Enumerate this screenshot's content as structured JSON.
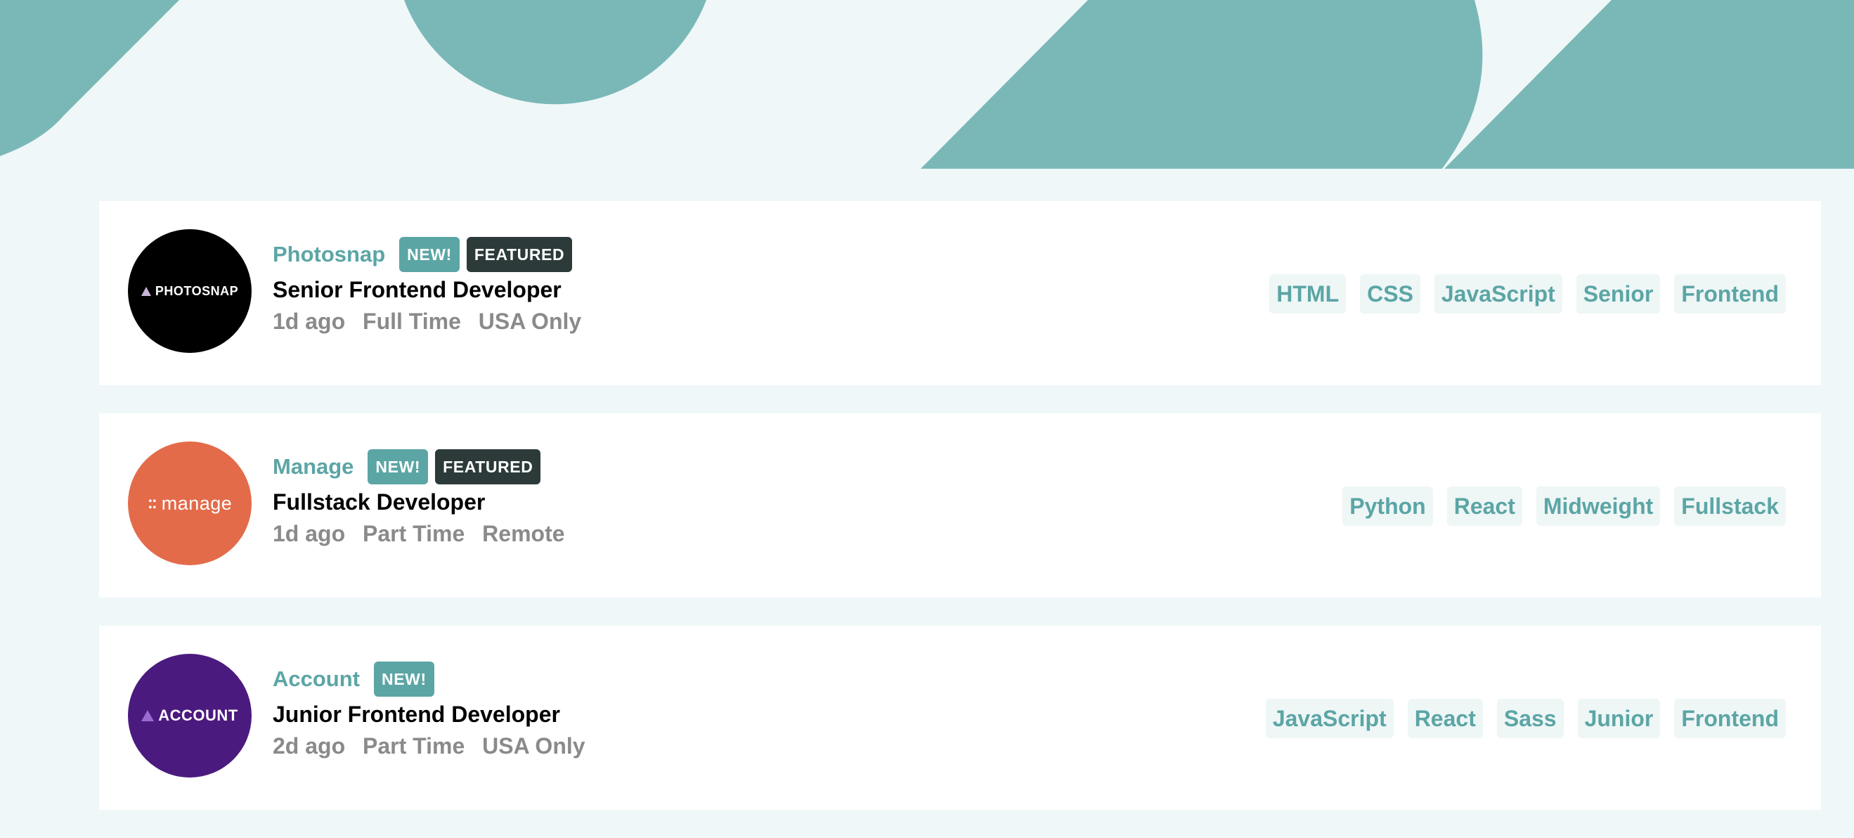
{
  "theme": {
    "primary": "#5ca5a5",
    "banner_shape": "#7ab8b7",
    "background": "#eff7f8",
    "card": "#ffffff",
    "tag_bg": "#eef6f6",
    "featured_bg": "#2c3a3a",
    "muted_text": "#8a8a8a"
  },
  "jobs": [
    {
      "company": "Photosnap",
      "logo": {
        "text": "PHOTOSNAP",
        "color": "#000000"
      },
      "new_label": "NEW!",
      "featured_label": "FEATURED",
      "position": "Senior Frontend Developer",
      "posted": "1d ago",
      "contract": "Full Time",
      "location": "USA Only",
      "tags": [
        "HTML",
        "CSS",
        "JavaScript",
        "Senior",
        "Frontend"
      ]
    },
    {
      "company": "Manage",
      "logo": {
        "text": "manage",
        "color": "#e36b4a"
      },
      "new_label": "NEW!",
      "featured_label": "FEATURED",
      "position": "Fullstack Developer",
      "posted": "1d ago",
      "contract": "Part Time",
      "location": "Remote",
      "tags": [
        "Python",
        "React",
        "Midweight",
        "Fullstack"
      ]
    },
    {
      "company": "Account",
      "logo": {
        "text": "ACCOUNT",
        "color": "#4b1a7e"
      },
      "new_label": "NEW!",
      "position": "Junior Frontend Developer",
      "posted": "2d ago",
      "contract": "Part Time",
      "location": "USA Only",
      "tags": [
        "JavaScript",
        "React",
        "Sass",
        "Junior",
        "Frontend"
      ]
    }
  ]
}
